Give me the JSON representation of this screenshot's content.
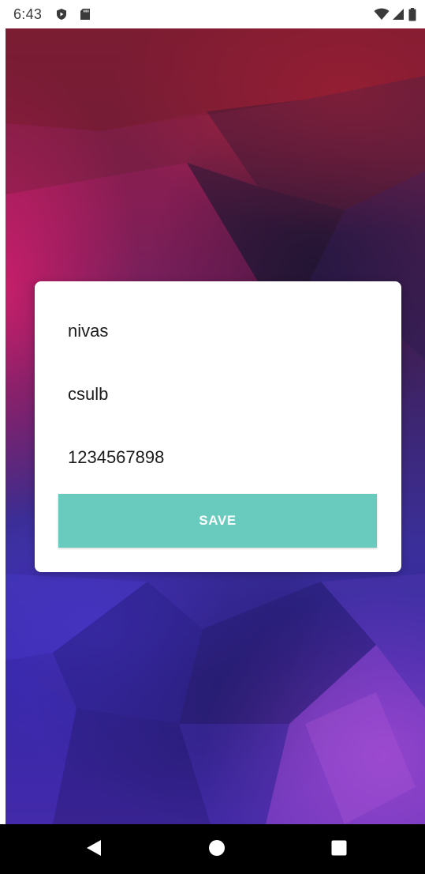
{
  "status_bar": {
    "time": "6:43",
    "icons": [
      "play-protect-icon",
      "sd-card-icon",
      "wifi-icon",
      "cell-signal-icon",
      "battery-icon"
    ]
  },
  "form": {
    "name_value": "nivas",
    "school_value": "csulb",
    "phone_value": "1234567898",
    "save_label": "SAVE"
  },
  "navigation": {
    "icons": [
      "back-icon",
      "home-icon",
      "recents-icon"
    ]
  },
  "colors": {
    "accent": "#68cbbd",
    "card": "#ffffff",
    "nav_bar": "#000000",
    "status_bar": "#ffffff"
  }
}
